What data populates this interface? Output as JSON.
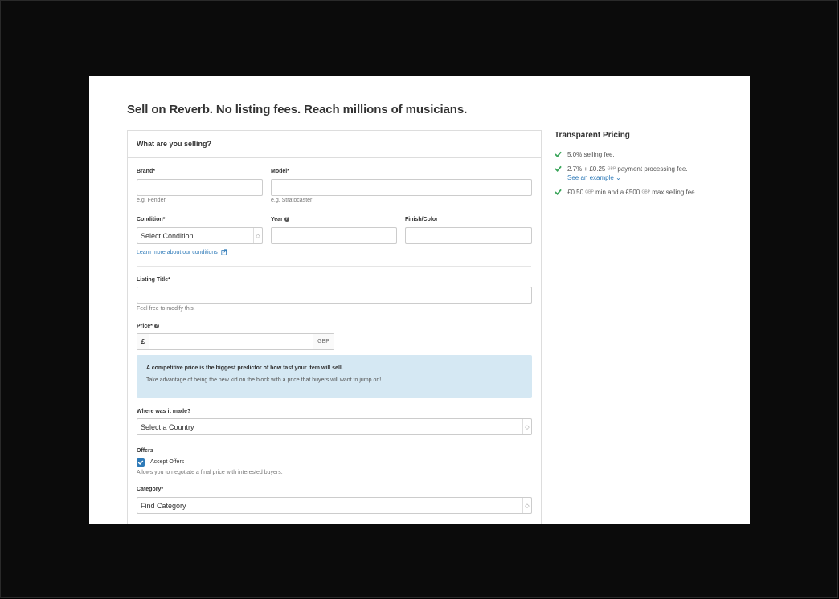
{
  "page": {
    "headline": "Sell on Reverb. No listing fees. Reach millions of musicians."
  },
  "form": {
    "section_title": "What are you selling?",
    "brand": {
      "label": "Brand*",
      "value": "",
      "hint": "e.g. Fender"
    },
    "model": {
      "label": "Model*",
      "value": "",
      "hint": "e.g. Stratocaster"
    },
    "condition": {
      "label": "Condition*",
      "selected": "Select Condition"
    },
    "year": {
      "label": "Year",
      "value": ""
    },
    "finish": {
      "label": "Finish/Color",
      "value": ""
    },
    "conditions_link": "Learn more about our conditions",
    "listing_title": {
      "label": "Listing Title*",
      "value": "",
      "hint": "Feel free to modify this."
    },
    "price": {
      "label": "Price*",
      "currency_symbol": "£",
      "currency_code": "GBP",
      "value": ""
    },
    "notice": {
      "title": "A competitive price is the biggest predictor of how fast your item will sell.",
      "body": "Take advantage of being the new kid on the block with a price that buyers will want to jump on!"
    },
    "origin": {
      "label": "Where was it made?",
      "selected": "Select a Country"
    },
    "offers": {
      "label": "Offers",
      "checkbox_label": "Accept Offers",
      "checked": true,
      "hint": "Allows you to negotiate a final price with interested buyers."
    },
    "category": {
      "label": "Category*",
      "selected": "Find Category"
    }
  },
  "pricing": {
    "title": "Transparent Pricing",
    "items": [
      {
        "text": "5.0% selling fee."
      },
      {
        "prefix": "2.7% + £0.25",
        "currency": "GBP",
        "suffix": "payment processing fee.",
        "link": "See an example"
      },
      {
        "prefix": "£0.50",
        "currency": "GBP",
        "middle": "min and a £500",
        "currency2": "GBP",
        "suffix": "max selling fee."
      }
    ]
  },
  "colors": {
    "accent": "#2e7ab8",
    "check": "#3aa55a",
    "notice_bg": "#d5e8f3",
    "frame": "#000000"
  }
}
